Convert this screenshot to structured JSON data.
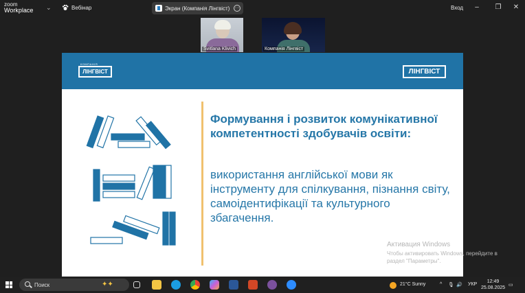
{
  "topbar": {
    "app_line1": "zoom",
    "app_line2": "Workplace",
    "meeting_name": "Вебінар",
    "share_label": "Экран (Компанія Лінгвіст)",
    "share_badge": "Л",
    "signin": "Вход"
  },
  "participants": [
    {
      "name": "Svitlana Klivich"
    },
    {
      "name": "Компанія Лінгвіст"
    }
  ],
  "slide": {
    "logo_left_top": "КОМПАНІЯ",
    "logo_left": "ЛІНГВІСТ",
    "logo_right": "ЛІНГВІСТ",
    "title": "Формування і розвиток комунікативної компетентності здобувачів освіти:",
    "subtitle": "використання англійської мови як інструменту для спілкування, пізнання світу, самоідентифікації та культурного збагачення.",
    "colors": {
      "header": "#2073a6",
      "accent": "#f0c16e",
      "text": "#2677a8"
    }
  },
  "watermark": {
    "title": "Активация Windows",
    "body": "Чтобы активировать Windows, перейдите в раздел \"Параметры\"."
  },
  "taskbar": {
    "search_placeholder": "Поиск",
    "weather": "21°C  Sunny",
    "language": "УКР",
    "time": "12:49",
    "date": "25.08.2025",
    "icons": [
      "start-icon",
      "search-icon",
      "task-view-icon",
      "file-explorer-icon",
      "edge-icon",
      "chrome-icon",
      "copilot-icon",
      "word-icon",
      "powerpoint-icon",
      "viber-icon",
      "zoom-icon"
    ]
  }
}
